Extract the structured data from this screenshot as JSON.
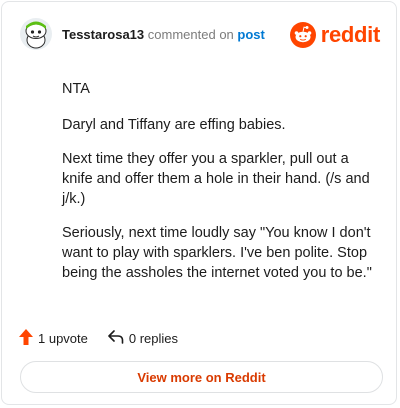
{
  "header": {
    "username": "Tesstarosa13",
    "action_text": "commented on",
    "post_link": "post",
    "brand": "reddit",
    "avatar_icon": "snoo-avatar-icon",
    "logo_icon": "reddit-logo-icon"
  },
  "comment": {
    "paragraphs": [
      "NTA",
      "Daryl and Tiffany are effing babies.",
      "Next time they offer you a sparkler, pull out a knife and offer them a hole in their hand. (/s and j/k.)",
      "Seriously, next time loudly say \"You know I don't want to play with sparklers. I've ben polite. Stop being the assholes the internet voted you to be.\""
    ]
  },
  "footer": {
    "upvotes": "1 upvote",
    "replies": "0 replies",
    "upvote_icon": "upvote-arrow-icon",
    "reply_icon": "reply-arrow-icon"
  },
  "cta": {
    "label": "View more on Reddit"
  },
  "colors": {
    "brand": "#ff4500",
    "link": "#0079d3",
    "cta_text": "#d93a00"
  }
}
